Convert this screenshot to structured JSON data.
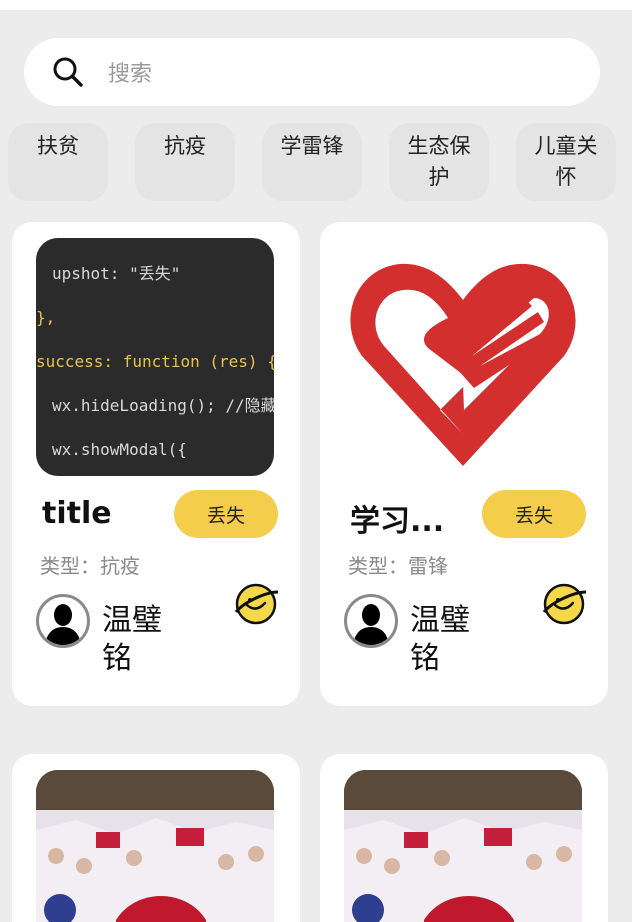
{
  "search": {
    "placeholder": "搜索",
    "icon": "search-icon"
  },
  "categories": [
    "扶贫",
    "抗疫",
    "学雷锋",
    "生态保护",
    "儿童关怀"
  ],
  "cards": [
    {
      "title": "title",
      "button_label": "丢失",
      "type_label": "类型：",
      "type_value": "抗疫",
      "user_name": "温璧铭",
      "thumb": "code-screenshot",
      "code_lines": [
        "upshot: \"丢失\"",
        "},",
        "success: function (res) {",
        "wx.hideLoading(); //隐藏正在加载",
        "wx.showModal({"
      ]
    },
    {
      "title": "学习...",
      "button_label": "丢失",
      "type_label": "类型：",
      "type_value": "雷锋",
      "user_name": "温璧铭",
      "thumb": "volunteer-heart-logo"
    },
    {
      "thumb": "crowd-photo"
    },
    {
      "thumb": "crowd-photo"
    }
  ],
  "colors": {
    "background": "#ececec",
    "card": "#ffffff",
    "accent_button": "#f5cd4c",
    "logo_red": "#d32f2f"
  }
}
